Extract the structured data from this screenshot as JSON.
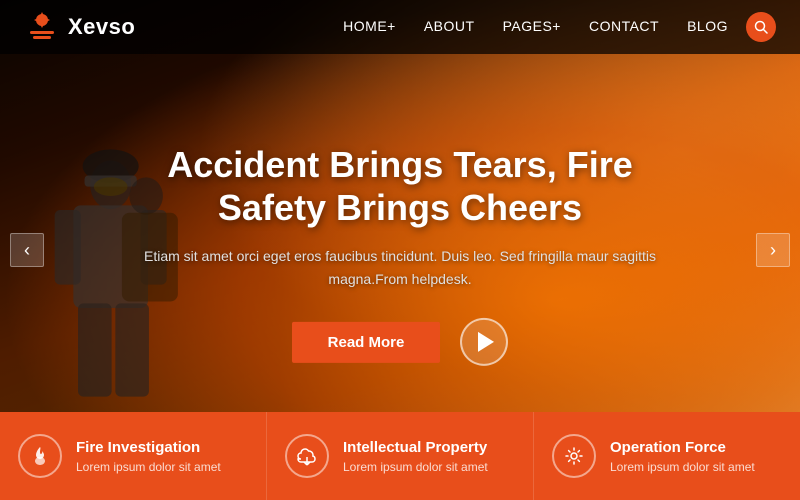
{
  "brand": {
    "name": "Xevso"
  },
  "nav": {
    "links": [
      {
        "label": "HOME+",
        "id": "home"
      },
      {
        "label": "ABOUT",
        "id": "about"
      },
      {
        "label": "PAGES+",
        "id": "pages"
      },
      {
        "label": "CONTACT",
        "id": "contact"
      },
      {
        "label": "BLOG",
        "id": "blog"
      }
    ],
    "search_placeholder": "Search"
  },
  "hero": {
    "title": "Accident Brings Tears, Fire Safety Brings Cheers",
    "subtitle": "Etiam sit amet orci eget eros faucibus tincidunt. Duis leo. Sed fringilla maur\nsagittis magna.From helpdesk.",
    "read_more_label": "Read More",
    "arrow_left": "‹",
    "arrow_right": "›"
  },
  "cards": [
    {
      "title": "Fire Investigation",
      "desc": "Lorem ipsum dolor sit amet",
      "icon": "🔥"
    },
    {
      "title": "Intellectual Property",
      "desc": "Lorem ipsum dolor sit amet",
      "icon": "☁"
    },
    {
      "title": "Operation Force",
      "desc": "Lorem ipsum dolor sit amet",
      "icon": "⚙"
    }
  ]
}
